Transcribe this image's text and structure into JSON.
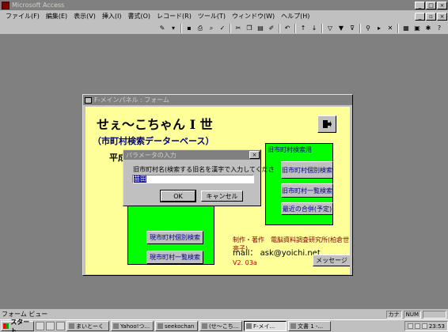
{
  "app": {
    "title": "Microsoft Access"
  },
  "menu": [
    "ファイル(F)",
    "編集(E)",
    "表示(V)",
    "挿入(I)",
    "書式(O)",
    "レコード(R)",
    "ツール(T)",
    "ウィンドウ(W)",
    "ヘルプ(H)"
  ],
  "form": {
    "window_title": "F-メインパネル : フォーム",
    "main_title": "せぇ～こちゃん I 世",
    "subtitle": "（市町村検索データーベース）",
    "heisei": "平成",
    "right_group_title": "旧市町村検索用",
    "btn_old_detail": "旧市町村個別検索",
    "btn_old_list": "旧市町村一覧検索",
    "btn_merge": "最近の合併(予定)",
    "btn_cur_detail": "現市町村個別検索",
    "btn_cur_list": "現市町村一覧検索",
    "credit": "制作・著作　電脳資料調査研究所(柏倉世亮子)",
    "mail": "mail：  ask@yoichi.net",
    "version": "V2. 03a",
    "btn_message": "メッセージ"
  },
  "dialog": {
    "title": "パラメータの入力",
    "prompt": "旧市町村名(検索する旧名を漢字で入力してくださ",
    "input_value": "苗田",
    "ok": "OK",
    "cancel": "キャンセル"
  },
  "status": {
    "text": "フォーム ビュー",
    "kana": "カナ",
    "num": "NUM"
  },
  "taskbar": {
    "start": "スタート",
    "tasks": [
      "まいとーく",
      "Yahoo!つ...",
      "seekochan",
      "(せ～こち...",
      "F-メイ...",
      "文書 1 -..."
    ],
    "clock": "23:53"
  },
  "colors": {
    "form_bg": "#ffff99",
    "panel_green": "#00ff00",
    "titlebar": "#808080",
    "accent_navy": "#000080"
  }
}
